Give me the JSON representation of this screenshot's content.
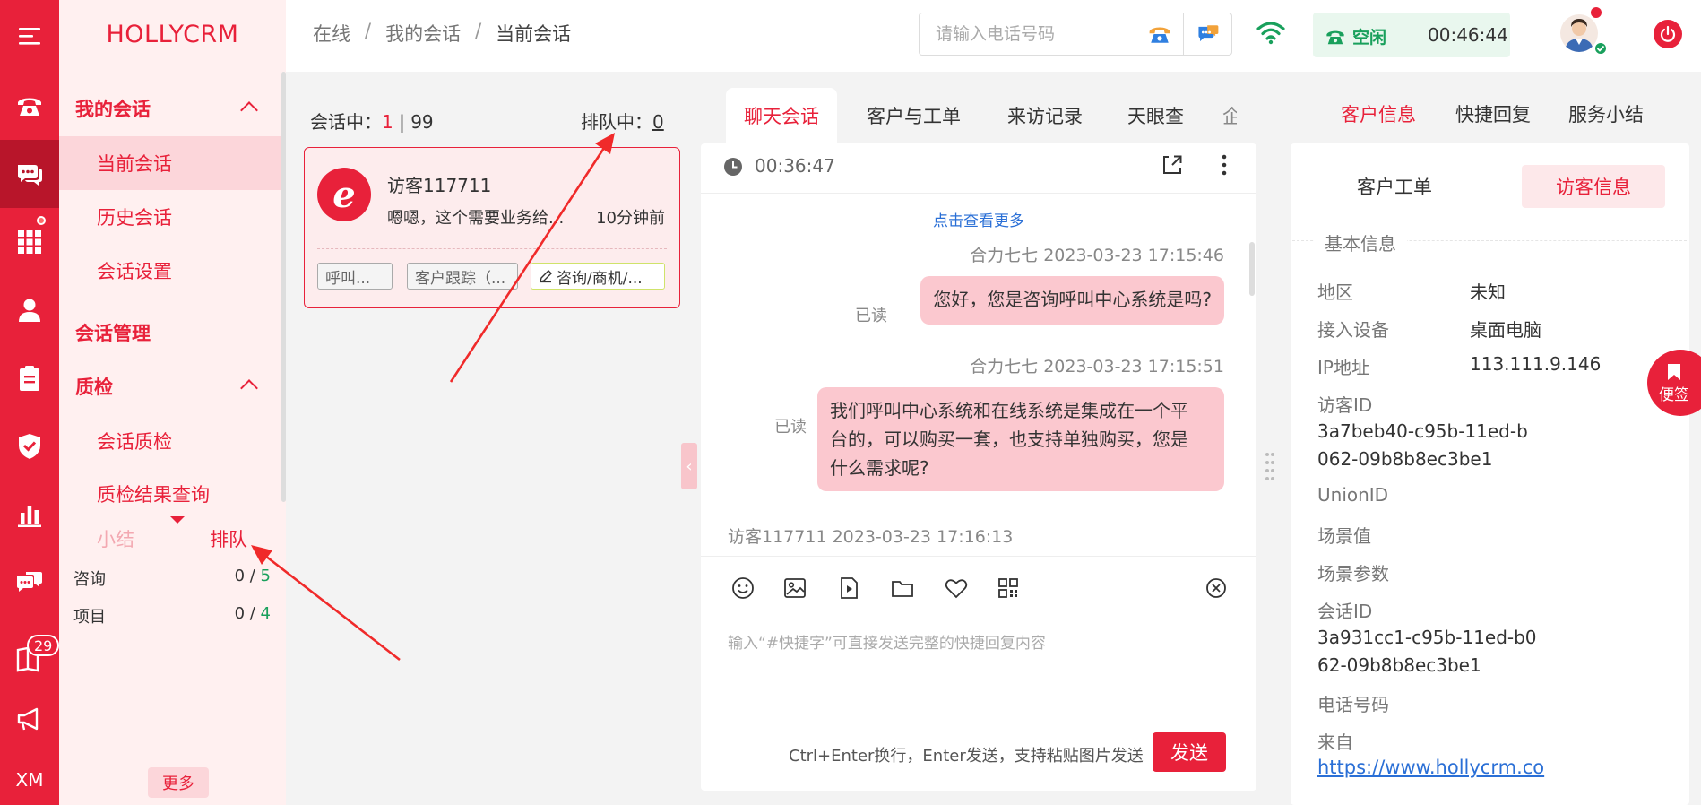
{
  "app": {
    "brand": "HOLLYCRM"
  },
  "rail": {
    "items": [
      {
        "icon": "menu-icon"
      },
      {
        "icon": "phone-icon"
      },
      {
        "icon": "chat-icon",
        "active": true
      },
      {
        "icon": "grid-icon",
        "dot": true
      },
      {
        "icon": "user-icon"
      },
      {
        "icon": "clipboard-icon"
      },
      {
        "icon": "shield-icon"
      },
      {
        "icon": "bar-chart-icon"
      },
      {
        "icon": "messages-icon"
      },
      {
        "icon": "book-icon",
        "badge": "29"
      },
      {
        "icon": "megaphone-icon"
      }
    ],
    "footer_text": "XM"
  },
  "sidebar": {
    "groups": [
      {
        "label": "我的会话",
        "expanded": true,
        "items": [
          "当前会话",
          "历史会话",
          "会话设置"
        ]
      },
      {
        "label": "会话管理"
      },
      {
        "label": "质检",
        "expanded": true,
        "items": [
          "会话质检",
          "质检结果查询"
        ]
      }
    ],
    "active_item": "当前会话",
    "bottom_tabs": [
      "小结",
      "排队"
    ],
    "active_bottom_tab": "排队",
    "stats": [
      {
        "label": "咨询",
        "current": "0",
        "sep": " / ",
        "total": "5"
      },
      {
        "label": "项目",
        "current": "0",
        "sep": " / ",
        "total": "4"
      }
    ],
    "more_label": "更多"
  },
  "topbar": {
    "breadcrumb": [
      "在线",
      "我的会话",
      "当前会话"
    ],
    "phone_placeholder": "请输入电话号码",
    "status_label": "空闲",
    "status_time": "00:46:44",
    "colors": {
      "accent": "#e8213a",
      "status_green": "#19a05c"
    }
  },
  "sessions": {
    "label": "会话中：",
    "count": "1",
    "separator": " | ",
    "max": "99",
    "queue_label": "排队中：",
    "queue_count": "0",
    "cards": [
      {
        "name": "访客117711",
        "preview": "嗯嗯，这个需要业务给...",
        "time": "10分钟前",
        "chips": [
          "呼叫...",
          "客户跟踪（...",
          "咨询/商机/..."
        ]
      }
    ]
  },
  "chat": {
    "tabs": [
      "聊天会话",
      "客户与工单",
      "来访记录",
      "天眼查",
      "企"
    ],
    "active_tab": "聊天会话",
    "duration": "00:36:47",
    "load_more": "点击查看更多",
    "read_label": "已读",
    "messages": [
      {
        "meta": "合力七七 2023-03-23 17:15:46",
        "text": "您好，您是咨询呼叫中心系统是吗?",
        "read": "已读"
      },
      {
        "meta": "合力七七 2023-03-23 17:15:51",
        "lines": [
          "我们呼叫中心系统和在线系统是集成在一个平",
          "台的，可以购买一套，也支持单独购买，您是",
          "什么需求呢?"
        ],
        "read": "已读"
      }
    ],
    "visitor_meta": "访客117711 2023-03-23 17:16:13",
    "composer_placeholder": "输入“#快捷字”可直接发送完整的快捷回复内容",
    "send_hint": "Ctrl+Enter换行，Enter发送，支持粘贴图片发送",
    "send_label": "发送"
  },
  "right": {
    "tabs": [
      "客户信息",
      "快捷回复",
      "服务小结"
    ],
    "active_tab": "客户信息",
    "subtabs": [
      "客户工单",
      "访客信息"
    ],
    "active_subtab": "访客信息",
    "section_title": "基本信息",
    "fields": {
      "region_label": "地区",
      "region": "未知",
      "device_label": "接入设备",
      "device": "桌面电脑",
      "ip_label": "IP地址",
      "ip": "113.111.9.146",
      "visitor_id_label": "访客ID",
      "visitor_id_1": "3a7beb40-c95b-11ed-b",
      "visitor_id_2": "062-09b8b8ec3be1",
      "union_label": "UnionID",
      "scene_label": "场景值",
      "scene_param_label": "场景参数",
      "session_id_label": "会话ID",
      "session_id_1": "3a931cc1-c95b-11ed-b0",
      "session_id_2": "62-09b8b8ec3be1",
      "phone_label": "电话号码",
      "source_label": "来自",
      "source": "https://www.hollycrm.co"
    },
    "sticky_label": "便签"
  }
}
